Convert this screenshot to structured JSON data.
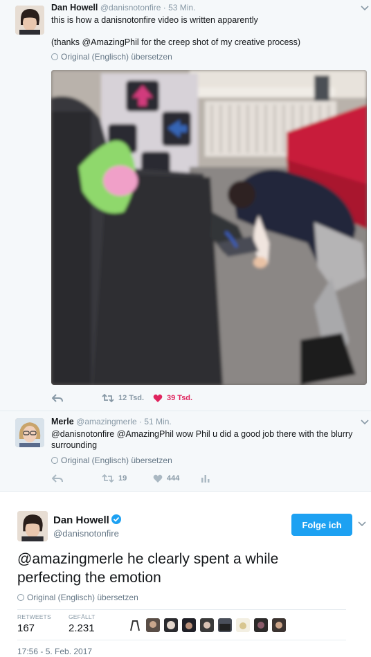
{
  "tweet1": {
    "name": "Dan Howell",
    "handle_time": "@danisnotonfire · 53 Min.",
    "text_line1": "this is how a danisnotonfire video is written apparently",
    "text_line2": "(thanks @AmazingPhil for the creep shot of my creative process)",
    "translate": "Original (Englisch) übersetzen",
    "retweets": "12 Tsd.",
    "likes": "39 Tsd.",
    "liked_color": "#e0245e"
  },
  "tweet2": {
    "name": "Merle",
    "handle_time": "@amazingmerle · 51 Min.",
    "text": "@danisnotonfire @AmazingPhil wow Phil u did a good job there with the blurry surrounding",
    "translate": "Original (Englisch) übersetzen",
    "retweets": "19",
    "likes": "444"
  },
  "focus": {
    "name": "Dan Howell",
    "handle": "@danisnotonfire",
    "follow_label": "Folge ich",
    "text": "@amazingmerle he clearly spent a while perfecting the emotion",
    "translate": "Original (Englisch) übersetzen",
    "retweets_label": "RETWEETS",
    "retweets": "167",
    "likes_label": "GEFÄLLT",
    "likes": "2.231",
    "timestamp": "17:56 - 5. Feb. 2017",
    "accent": "#1da1f2"
  }
}
